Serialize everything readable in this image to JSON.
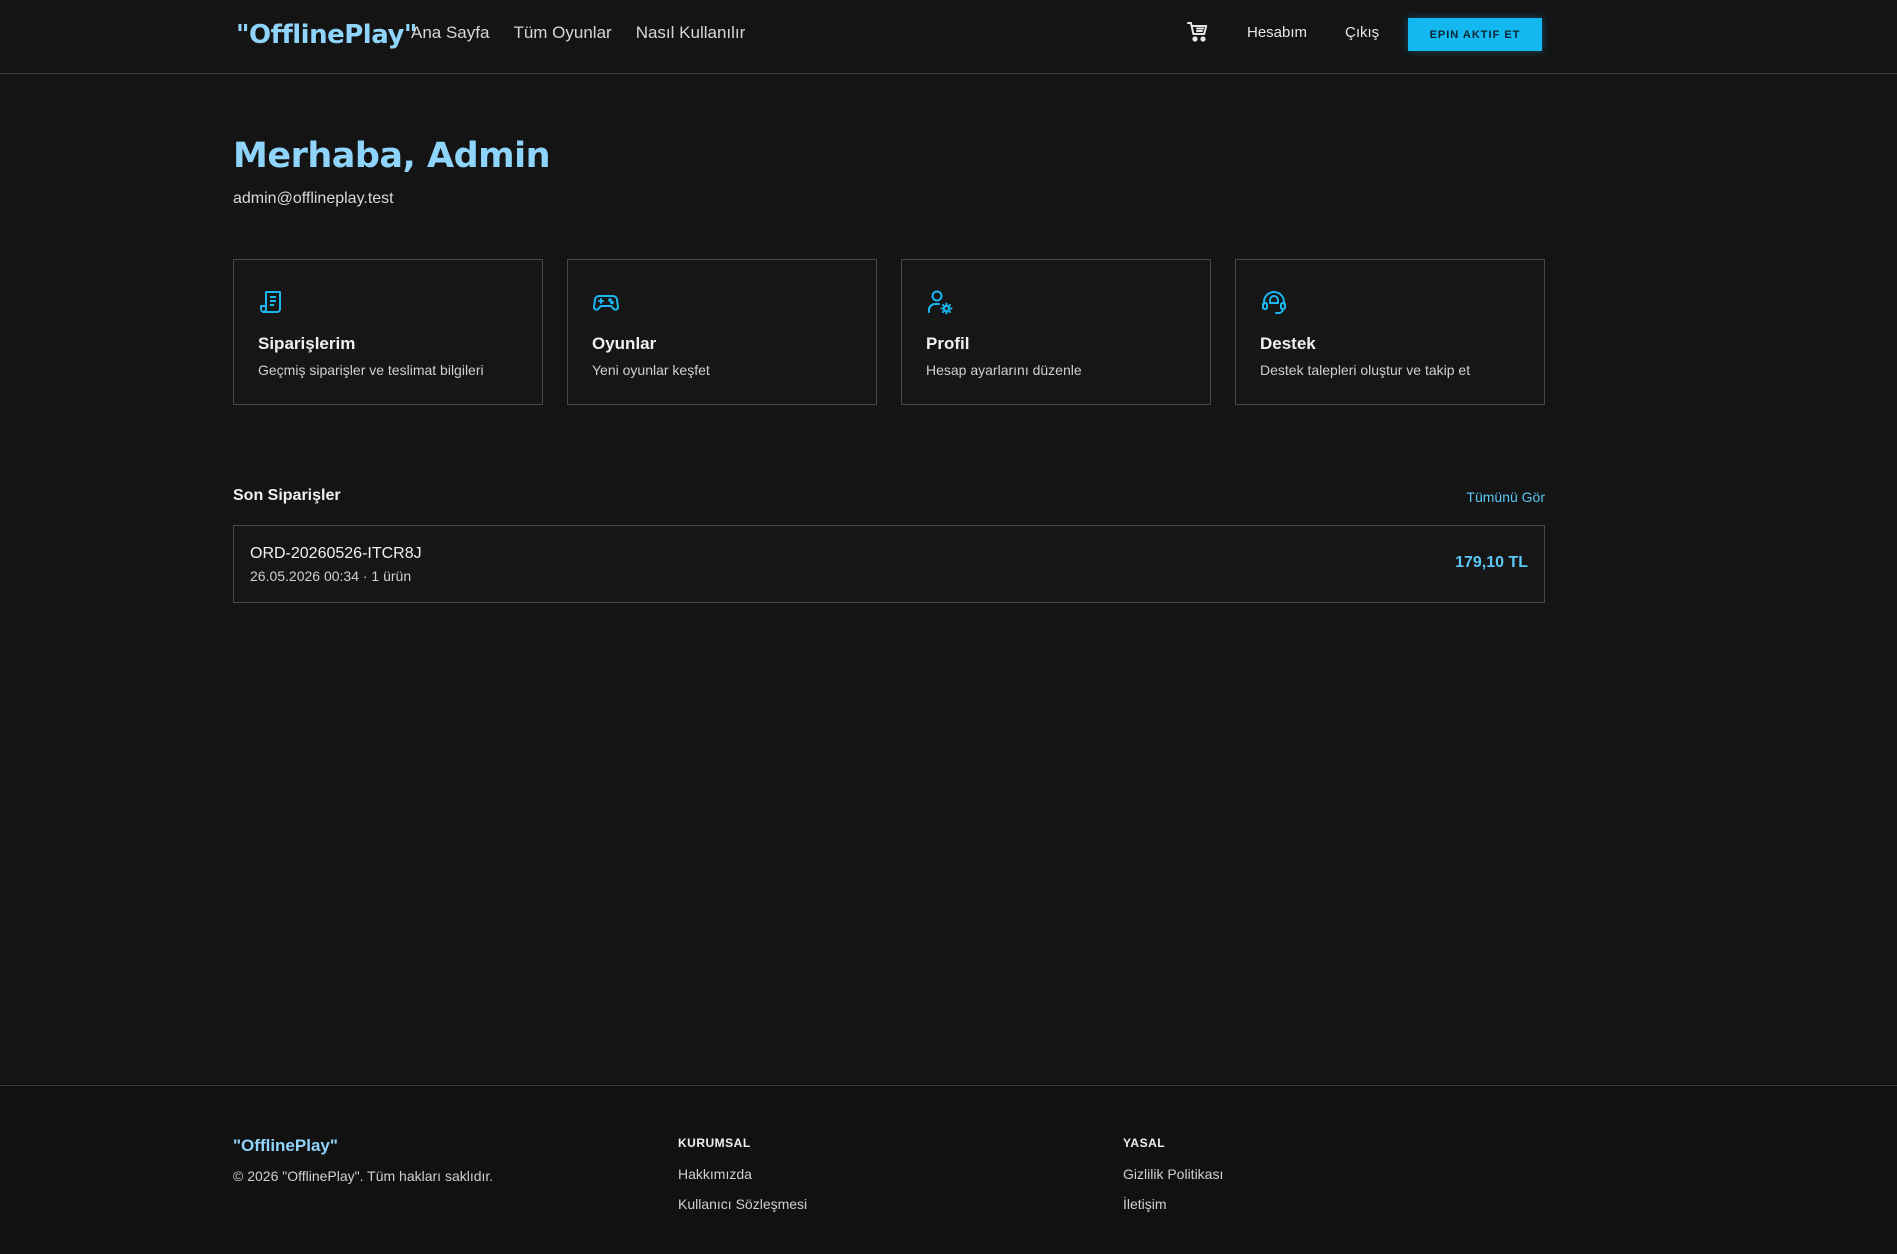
{
  "header": {
    "logo": "\"OfflinePlay\"",
    "nav": [
      "Ana Sayfa",
      "Tüm Oyunlar",
      "Nasıl Kullanılır"
    ],
    "cart_icon": "cart-icon",
    "account_label": "Hesabım",
    "logout_label": "Çıkış",
    "epin_button": "EPIN AKTIF ET"
  },
  "greeting": {
    "title": "Merhaba, Admin",
    "email": "admin@offlineplay.test"
  },
  "cards": [
    {
      "icon": "receipt-icon",
      "title": "Siparişlerim",
      "desc": "Geçmiş siparişler ve teslimat bilgileri"
    },
    {
      "icon": "gamepad-icon",
      "title": "Oyunlar",
      "desc": "Yeni oyunlar keşfet"
    },
    {
      "icon": "user-settings-icon",
      "title": "Profil",
      "desc": "Hesap ayarlarını düzenle"
    },
    {
      "icon": "headset-icon",
      "title": "Destek",
      "desc": "Destek talepleri oluştur ve takip et"
    }
  ],
  "recent_orders": {
    "title": "Son Siparişler",
    "see_all": "Tümünü Gör",
    "orders": [
      {
        "id": "ORD-20260526-ITCR8J",
        "meta": "26.05.2026 00:34 · 1 ürün",
        "total": "179,10 TL"
      }
    ]
  },
  "footer": {
    "logo": "\"OfflinePlay\"",
    "copyright": "© 2026 \"OfflinePlay\". Tüm hakları saklıdır.",
    "corporate": {
      "heading": "KURUMSAL",
      "links": [
        "Hakkımızda",
        "Kullanıcı Sözleşmesi"
      ]
    },
    "legal": {
      "heading": "YASAL",
      "links": [
        "Gizlilik Politikası",
        "İletişim"
      ]
    }
  },
  "colors": {
    "accent": "#14b8f0",
    "accent_text": "#8fd4fb",
    "background": "#141414"
  }
}
